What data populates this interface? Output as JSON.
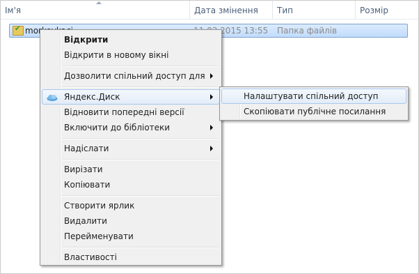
{
  "columns": {
    "name": "Ім'я",
    "date": "Дата змінення",
    "type": "Тип",
    "size": "Розмір"
  },
  "file": {
    "name": "morkovkaci",
    "date": "11.03.2015 13:55",
    "type": "Папка файлів",
    "icon": "synced-folder-icon"
  },
  "context_menu": {
    "open": "Відкрити",
    "open_new_window": "Відкрити в новому вікні",
    "share_with": "Дозволити спільний доступ для",
    "yandex_disk": "Яндекс.Диск",
    "restore_versions": "Відновити попередні версії",
    "include_library": "Включити до бібліотеки",
    "send_to": "Надіслати",
    "cut": "Вирізати",
    "copy": "Копіювати",
    "create_shortcut": "Створити ярлик",
    "delete": "Видалити",
    "rename": "Перейменувати",
    "properties": "Властивості"
  },
  "submenu": {
    "configure_sharing": "Налаштувати спільний доступ",
    "copy_public_link": "Скопіювати публічне посилання"
  },
  "colors": {
    "highlight_border": "#a8c8ec",
    "selection_fill": "#c1dcfc",
    "header_text": "#4c607a"
  }
}
